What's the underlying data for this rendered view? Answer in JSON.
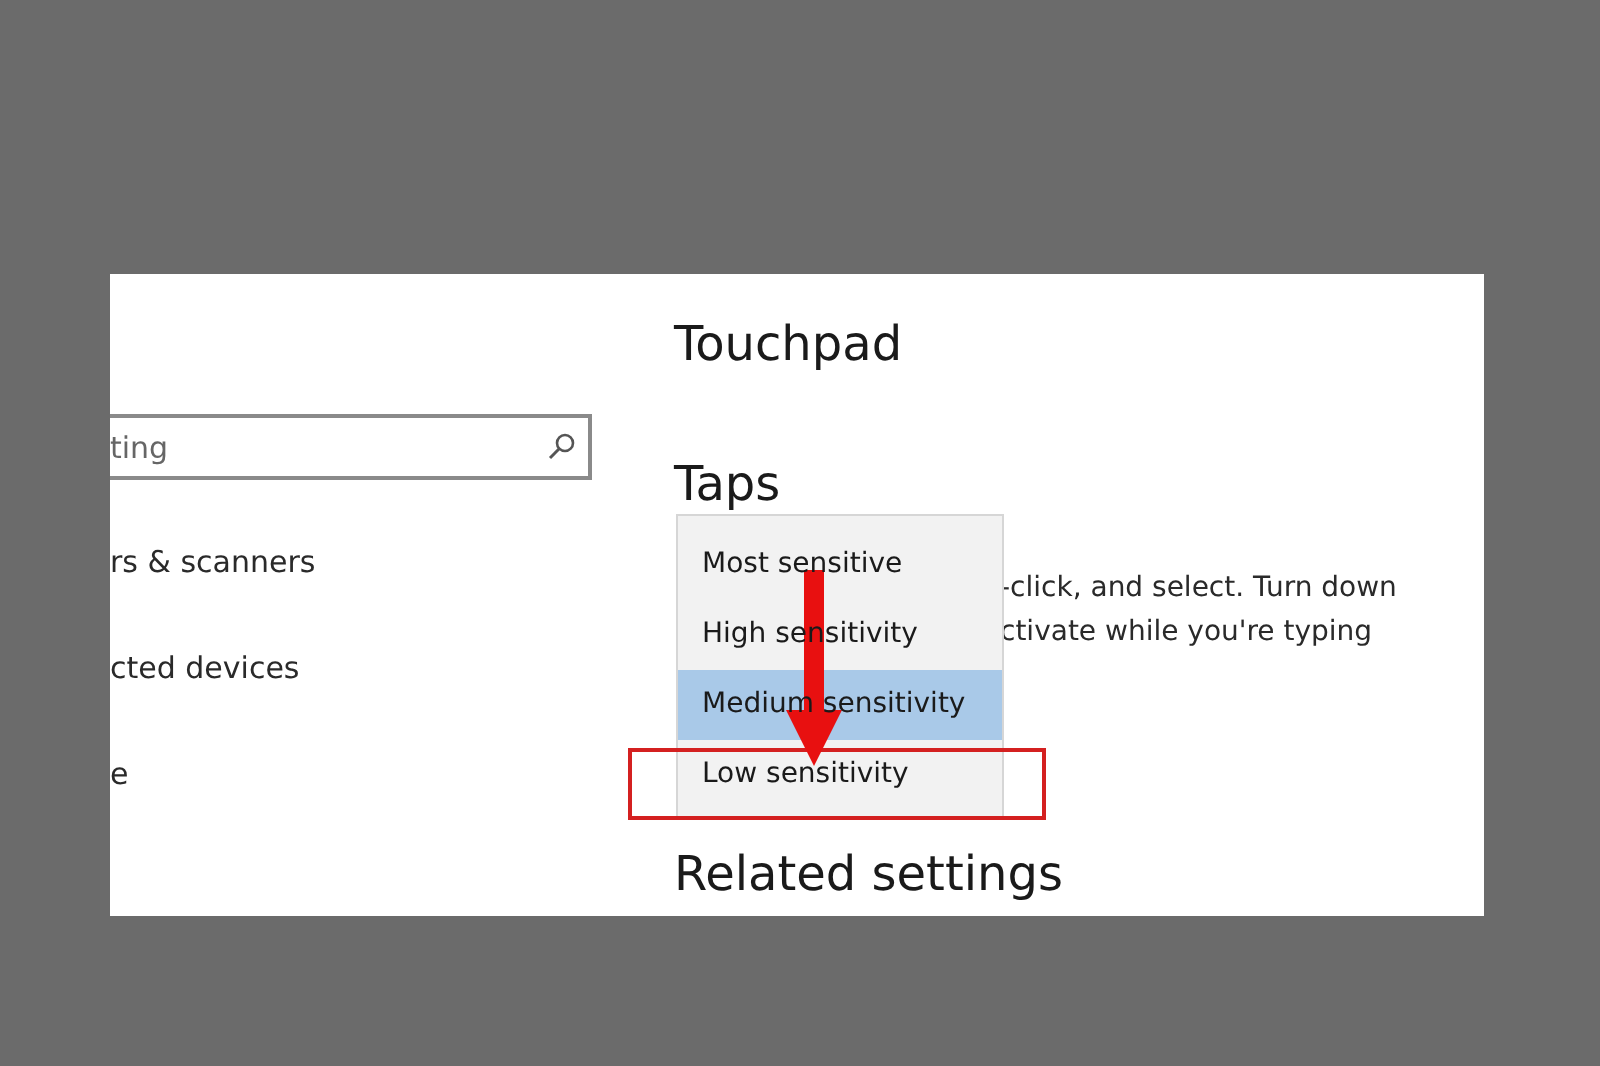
{
  "search": {
    "placeholder": "ting"
  },
  "sidebar": {
    "items": [
      {
        "label": "rs & scanners"
      },
      {
        "label": "cted devices"
      },
      {
        "label": "e"
      }
    ]
  },
  "page": {
    "title": "Touchpad",
    "section": "Taps",
    "description": [
      "-click, and select. Turn down",
      "ctivate while you're typing"
    ],
    "related_heading": "Related settings"
  },
  "dropdown": {
    "options": [
      {
        "label": "Most sensitive",
        "selected": false
      },
      {
        "label": "High sensitivity",
        "selected": false
      },
      {
        "label": "Medium sensitivity",
        "selected": true
      },
      {
        "label": "Low sensitivity",
        "selected": false
      }
    ]
  }
}
